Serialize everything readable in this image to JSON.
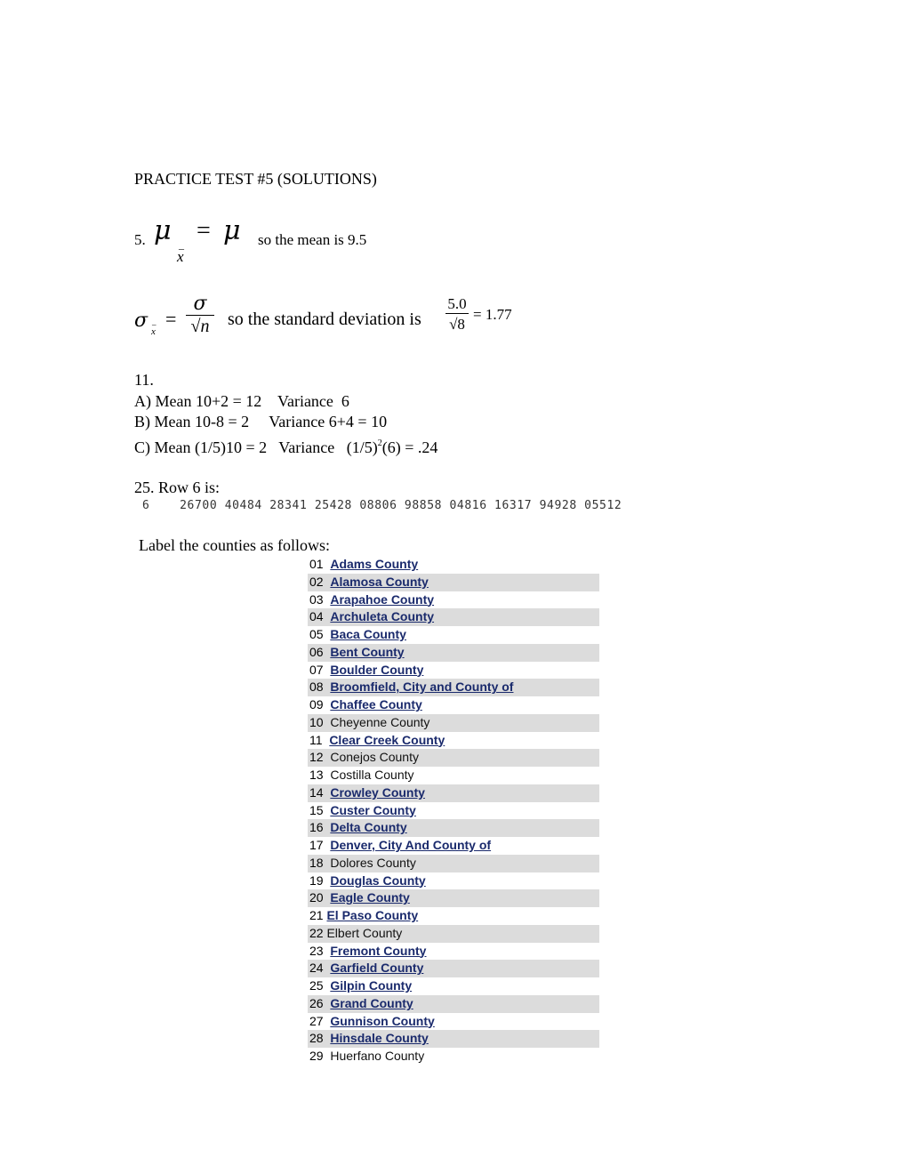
{
  "title": "PRACTICE TEST #5  (SOLUTIONS)",
  "q5": {
    "number": "5.",
    "symbol_mu": "μ",
    "sub_bar": "_",
    "sub_x": "x",
    "equals": "=",
    "text": "so the mean is 9.5"
  },
  "sd": {
    "sigma": "σ",
    "sub_x": "x",
    "sub_bar": "_",
    "equals": "=",
    "frac1_num": "σ",
    "frac1_den": "√n",
    "text": "so the standard deviation is",
    "frac2_num": "5.0",
    "frac2_den": "√8",
    "result": "= 1.77"
  },
  "q11": {
    "number": "11.",
    "a": "A) Mean 10+2 = 12    Variance  6",
    "b": "B) Mean 10-8 = 2     Variance 6+4 = 10",
    "c_prefix": "C) Mean (1/5)10 = 2   Variance   (1/5)",
    "c_sup": "2",
    "c_suffix": "(6) = .24"
  },
  "q25": {
    "heading": "25. Row 6 is:",
    "row": "6    26700 40484 28341 25428 08806 98858 04816 16317 94928 05512"
  },
  "label_heading": "Label the counties as follows:",
  "counties": [
    {
      "code": "01",
      "name": "Adams County",
      "link": true
    },
    {
      "code": "02",
      "name": "Alamosa County",
      "link": true
    },
    {
      "code": "03",
      "name": "Arapahoe County",
      "link": true
    },
    {
      "code": "04",
      "name": "Archuleta County",
      "link": true
    },
    {
      "code": "05",
      "name": "Baca County",
      "link": true
    },
    {
      "code": "06",
      "name": "Bent County",
      "link": true
    },
    {
      "code": "07",
      "name": "Boulder County",
      "link": true
    },
    {
      "code": "08",
      "name": "Broomfield, City and County of",
      "link": true
    },
    {
      "code": "09",
      "name": "Chaffee County",
      "link": true
    },
    {
      "code": "10",
      "name": "Cheyenne County",
      "link": false
    },
    {
      "code": "11",
      "name": "Clear Creek County",
      "link": true
    },
    {
      "code": "12",
      "name": "Conejos County",
      "link": false
    },
    {
      "code": "13",
      "name": "Costilla County",
      "link": false
    },
    {
      "code": "14",
      "name": "Crowley County",
      "link": true
    },
    {
      "code": "15",
      "name": "Custer County",
      "link": true
    },
    {
      "code": "16",
      "name": "Delta County",
      "link": true
    },
    {
      "code": "17",
      "name": "Denver, City And County of",
      "link": true
    },
    {
      "code": "18",
      "name": "Dolores County",
      "link": false
    },
    {
      "code": "19",
      "name": "Douglas County",
      "link": true
    },
    {
      "code": "20",
      "name": "Eagle County",
      "link": true
    },
    {
      "code": "21",
      "name": "El Paso County",
      "link": true
    },
    {
      "code": "22",
      "name": "Elbert County",
      "link": false
    },
    {
      "code": "23",
      "name": "Fremont County",
      "link": true
    },
    {
      "code": "24",
      "name": "Garfield County",
      "link": true
    },
    {
      "code": "25",
      "name": "Gilpin County",
      "link": true
    },
    {
      "code": "26",
      "name": "Grand County",
      "link": true
    },
    {
      "code": "27",
      "name": "Gunnison County",
      "link": true
    },
    {
      "code": "28",
      "name": "Hinsdale County",
      "link": true
    },
    {
      "code": "29",
      "name": "Huerfano County",
      "link": false
    }
  ],
  "colors": {
    "link": "#1a2a6c",
    "row_alt": "#dcdcdc"
  }
}
